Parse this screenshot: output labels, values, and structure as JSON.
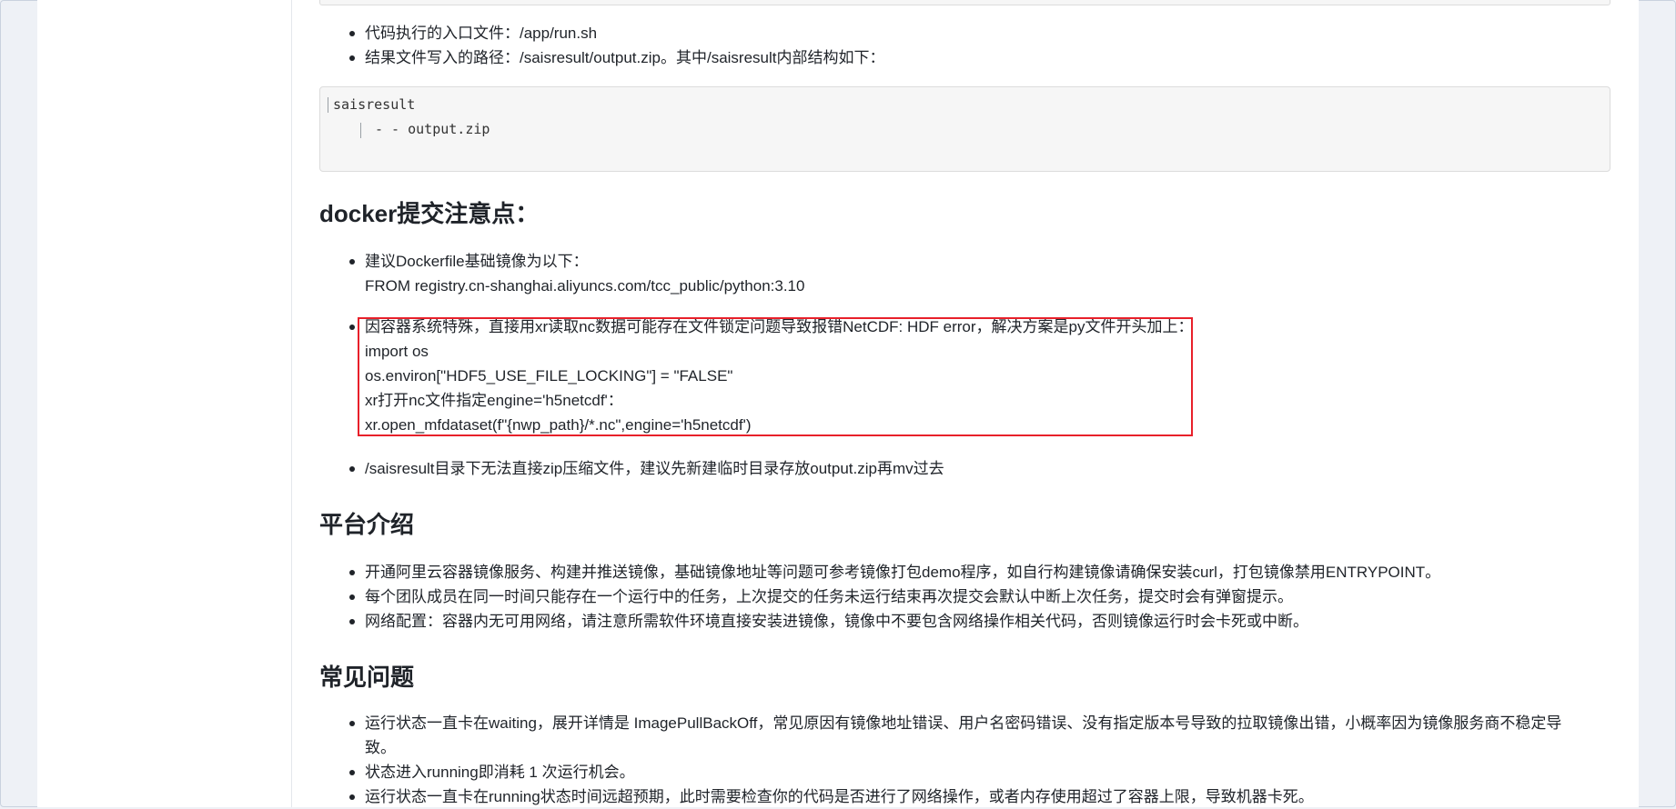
{
  "intro_list": [
    "代码执行的入口文件：/app/run.sh",
    "结果文件写入的路径：/saisresult/output.zip。其中/saisresult内部结构如下："
  ],
  "code_block": {
    "line1": "saisresult",
    "line2": "- - output.zip"
  },
  "sections": {
    "docker": {
      "heading": "docker提交注意点：",
      "item1_line1": "建议Dockerfile基础镜像为以下：",
      "item1_line2": "FROM registry.cn-shanghai.aliyuncs.com/tcc_public/python:3.10",
      "item2_lines": [
        "因容器系统特殊，直接用xr读取nc数据可能存在文件锁定问题导致报错NetCDF: HDF error，解决方案是py文件开头加上：",
        "import os",
        "os.environ[\"HDF5_USE_FILE_LOCKING\"] = \"FALSE\"",
        "xr打开nc文件指定engine='h5netcdf'：",
        "xr.open_mfdataset(f\"{nwp_path}/*.nc\",engine='h5netcdf')"
      ],
      "item3": "/saisresult目录下无法直接zip压缩文件，建议先新建临时目录存放output.zip再mv过去"
    },
    "platform": {
      "heading": "平台介绍",
      "items": [
        "开通阿里云容器镜像服务、构建并推送镜像，基础镜像地址等问题可参考镜像打包demo程序，如自行构建镜像请确保安装curl，打包镜像禁用ENTRYPOINT。",
        "每个团队成员在同一时间只能存在一个运行中的任务，上次提交的任务未运行结束再次提交会默认中断上次任务，提交时会有弹窗提示。",
        "网络配置：容器内无可用网络，请注意所需软件环境直接安装进镜像，镜像中不要包含网络操作相关代码，否则镜像运行时会卡死或中断。"
      ]
    },
    "faq": {
      "heading": "常见问题",
      "item1_line1": "运行状态一直卡在waiting，展开详情是 ImagePullBackOff，常见原因有镜像地址错误、用户名密码错误、没有指定版本号导致的拉取镜像出错，小概率因为镜像服务商不稳定导",
      "item1_line2": "致。",
      "item2": "状态进入running即消耗 1 次运行机会。",
      "item3": "运行状态一直卡在running状态时间远超预期，此时需要检查你的代码是否进行了网络操作，或者内存使用超过了容器上限，导致机器卡死。"
    }
  },
  "colors": {
    "highlight_border": "#e8202a",
    "page_background": "#eef1f6",
    "text": "#1f2329"
  }
}
